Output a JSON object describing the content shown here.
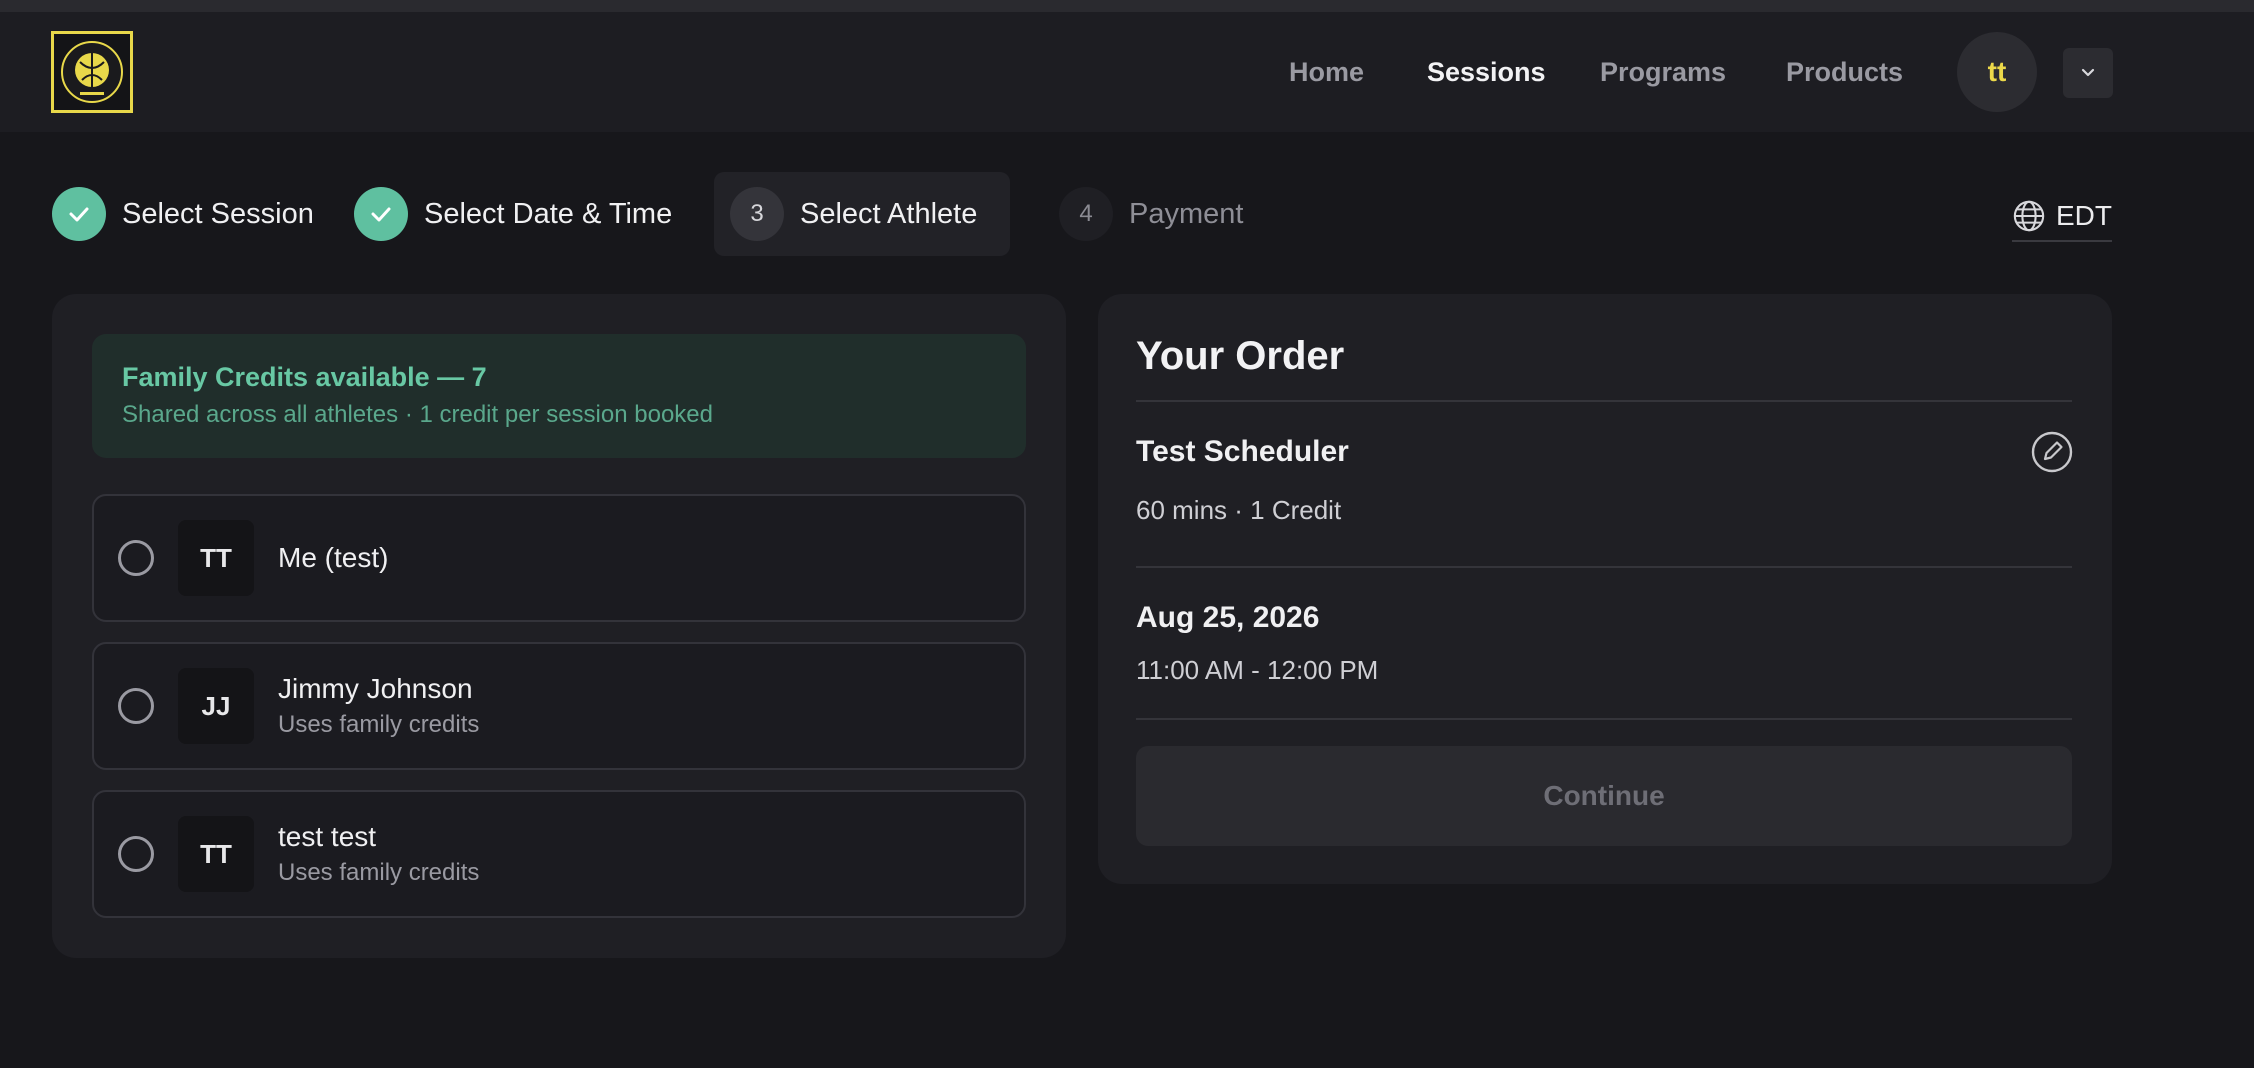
{
  "nav": {
    "links": [
      {
        "label": "Home",
        "active": false
      },
      {
        "label": "Sessions",
        "active": true
      },
      {
        "label": "Programs",
        "active": false
      },
      {
        "label": "Products",
        "active": false
      }
    ],
    "avatar_initials": "tt"
  },
  "steps": [
    {
      "label": "Select Session",
      "state": "done"
    },
    {
      "label": "Select Date & Time",
      "state": "done"
    },
    {
      "label": "Select Athlete",
      "number": "3",
      "state": "current"
    },
    {
      "label": "Payment",
      "number": "4",
      "state": "future"
    }
  ],
  "timezone": "EDT",
  "credits": {
    "title": "Family Credits available — 7",
    "subtitle": "Shared across all athletes · 1 credit per session booked"
  },
  "athletes": [
    {
      "initials": "TT",
      "name": "Me (test)",
      "sub": ""
    },
    {
      "initials": "JJ",
      "name": "Jimmy Johnson",
      "sub": "Uses family credits"
    },
    {
      "initials": "TT",
      "name": "test test",
      "sub": "Uses family credits"
    }
  ],
  "order": {
    "title": "Your Order",
    "session_name": "Test Scheduler",
    "session_details": "60 mins · 1 Credit",
    "date": "Aug 25, 2026",
    "time": "11:00 AM - 12:00 PM",
    "continue_label": "Continue"
  },
  "colors": {
    "accent_green": "#5fc0a0",
    "brand_yellow": "#ecd94a",
    "background": "#17171b",
    "panel": "#1f1f24"
  },
  "icons": [
    "logo-icon",
    "check-icon",
    "globe-icon",
    "chevron-down-icon",
    "edit-icon"
  ]
}
